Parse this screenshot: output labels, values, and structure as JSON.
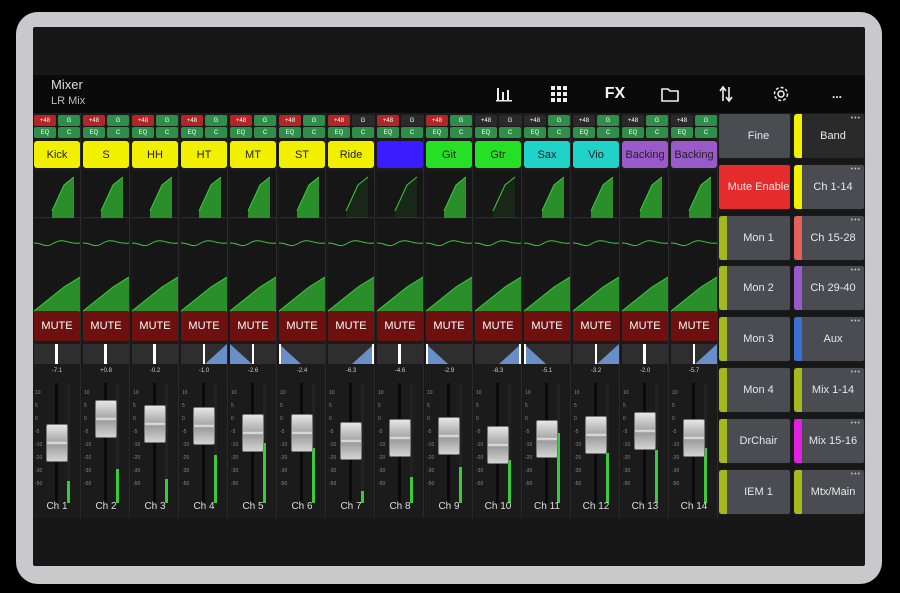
{
  "header": {
    "title": "Mixer",
    "subtitle": "LR Mix",
    "icons": [
      "meters-icon",
      "grid-icon",
      "fx-icon",
      "folder-icon",
      "routing-icon",
      "gear-icon",
      "more-icon"
    ],
    "fx_label": "FX",
    "more_label": "..."
  },
  "labels": {
    "p48": "+48",
    "g": "G",
    "eq": "EQ",
    "c": "C",
    "mute": "MUTE"
  },
  "channels": [
    {
      "name": "Kick",
      "color": "#f0f000",
      "label": "Ch 1",
      "gain": "-7.1",
      "p48": true,
      "gon": true,
      "fader": 0.5,
      "meter": 0.18,
      "pan": "center"
    },
    {
      "name": "S",
      "color": "#f0f000",
      "label": "Ch 2",
      "gain": "+0.8",
      "p48": true,
      "gon": true,
      "fader": 0.7,
      "meter": 0.28,
      "pan": "center"
    },
    {
      "name": "HH",
      "color": "#f0f000",
      "label": "Ch 3",
      "gain": "-0.2",
      "p48": true,
      "gon": true,
      "fader": 0.66,
      "meter": 0.2,
      "pan": "center"
    },
    {
      "name": "HT",
      "color": "#f0f000",
      "label": "Ch 4",
      "gain": "-1.0",
      "p48": true,
      "gon": true,
      "fader": 0.64,
      "meter": 0.4,
      "pan": "right"
    },
    {
      "name": "MT",
      "color": "#f0f000",
      "label": "Ch 5",
      "gain": "-2.6",
      "p48": true,
      "gon": true,
      "fader": 0.58,
      "meter": 0.5,
      "pan": "left"
    },
    {
      "name": "ST",
      "color": "#f0f000",
      "label": "Ch 6",
      "gain": "-2.4",
      "p48": true,
      "gon": true,
      "fader": 0.58,
      "meter": 0.46,
      "pan": "leftwide"
    },
    {
      "name": "Ride",
      "color": "#f0f000",
      "label": "Ch 7",
      "gain": "-6.3",
      "p48": true,
      "gon": false,
      "fader": 0.52,
      "meter": 0.1,
      "pan": "rightwide"
    },
    {
      "name": "",
      "color": "#3b1cff",
      "label": "Ch 8",
      "gain": "-4.6",
      "p48": true,
      "gon": false,
      "fader": 0.54,
      "meter": 0.22,
      "pan": "center"
    },
    {
      "name": "Git",
      "color": "#25e025",
      "label": "Ch 9",
      "gain": "-2.9",
      "p48": true,
      "gon": true,
      "fader": 0.56,
      "meter": 0.3,
      "pan": "leftwide"
    },
    {
      "name": "Gtr",
      "color": "#25e025",
      "label": "Ch 10",
      "gain": "-8.3",
      "p48": false,
      "gon": false,
      "fader": 0.48,
      "meter": 0.36,
      "pan": "rightwide"
    },
    {
      "name": "Sax",
      "color": "#1fd3c8",
      "label": "Ch 11",
      "gain": "-5.1",
      "p48": false,
      "gon": true,
      "fader": 0.53,
      "meter": 0.58,
      "pan": "leftwide"
    },
    {
      "name": "Vio",
      "color": "#1fd3c8",
      "label": "Ch 12",
      "gain": "-3.2",
      "p48": false,
      "gon": true,
      "fader": 0.57,
      "meter": 0.42,
      "pan": "right"
    },
    {
      "name": "Backing",
      "color": "#9b5ac9",
      "label": "Ch 13",
      "gain": "-2.0",
      "p48": false,
      "gon": true,
      "fader": 0.6,
      "meter": 0.44,
      "pan": "center"
    },
    {
      "name": "Backing",
      "color": "#9b5ac9",
      "label": "Ch 14",
      "gain": "-5.7",
      "p48": false,
      "gon": true,
      "fader": 0.54,
      "meter": 0.46,
      "pan": "right"
    }
  ],
  "fader_scale": [
    "10",
    "5",
    "0",
    "-5",
    "-10",
    "-20",
    "-30",
    "-50"
  ],
  "right_col1": [
    {
      "label": "Fine",
      "bar": "",
      "bg": "#4a4c52"
    },
    {
      "label": "Mute Enable",
      "bar": "",
      "bg": "#e52b2b"
    },
    {
      "label": "Mon 1",
      "bar": "#a5b81d",
      "bg": "#4a4c52"
    },
    {
      "label": "Mon 2",
      "bar": "#a5b81d",
      "bg": "#4a4c52"
    },
    {
      "label": "Mon 3",
      "bar": "#a5b81d",
      "bg": "#4a4c52"
    },
    {
      "label": "Mon 4",
      "bar": "#a5b81d",
      "bg": "#4a4c52"
    },
    {
      "label": "DrChair",
      "bar": "#a5b81d",
      "bg": "#4a4c52"
    },
    {
      "label": "IEM 1",
      "bar": "#a5b81d",
      "bg": "#4a4c52"
    }
  ],
  "right_col2": [
    {
      "label": "Band",
      "bar": "#f0f000",
      "bg": "#2a2a2a"
    },
    {
      "label": "Ch 1-14",
      "bar": "#f0f000",
      "bg": "#4a4c52"
    },
    {
      "label": "Ch 15-28",
      "bar": "#e5605a",
      "bg": "#4a4c52"
    },
    {
      "label": "Ch 29-40",
      "bar": "#9b5ac9",
      "bg": "#4a4c52"
    },
    {
      "label": "Aux",
      "bar": "#3a70d0",
      "bg": "#4a4c52"
    },
    {
      "label": "Mix 1-14",
      "bar": "#a5b81d",
      "bg": "#4a4c52"
    },
    {
      "label": "Mix 15-16",
      "bar": "#e021e0",
      "bg": "#4a4c52"
    },
    {
      "label": "Mtx/Main",
      "bar": "#a5b81d",
      "bg": "#4a4c52"
    }
  ]
}
